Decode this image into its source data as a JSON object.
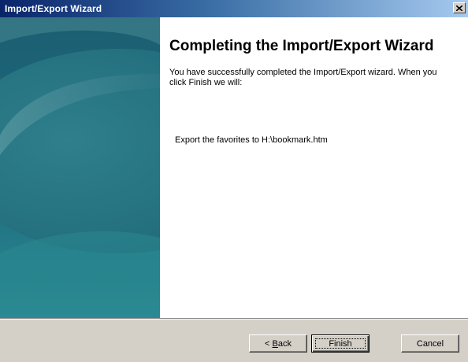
{
  "window": {
    "title": "Import/Export Wizard",
    "close_icon": "close-icon"
  },
  "colors": {
    "title_start": "#0a246a",
    "title_end": "#a6caf0",
    "side_panel": "#1e6876",
    "face": "#d4d0c8"
  },
  "main": {
    "heading": "Completing the Import/Export Wizard",
    "description": "You have successfully completed the Import/Export wizard. When you click Finish we will:",
    "action": "Export the favorites to H:\\bookmark.htm"
  },
  "buttons": {
    "back_prefix": "< ",
    "back_mnemonic": "B",
    "back_rest": "ack",
    "finish": "Finish",
    "cancel": "Cancel"
  }
}
